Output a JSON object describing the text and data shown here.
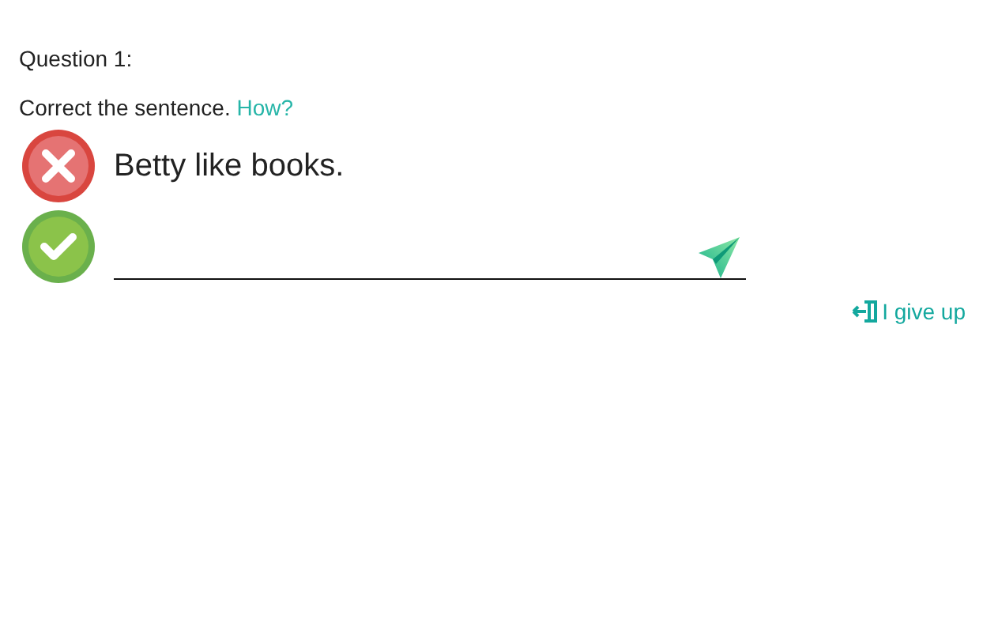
{
  "question": {
    "label": "Question 1:"
  },
  "instruction": {
    "text": "Correct the sentence.",
    "help_link": "How?"
  },
  "wrong_sentence": {
    "text": "Betty like books."
  },
  "give_up": {
    "label": "I give up"
  }
}
